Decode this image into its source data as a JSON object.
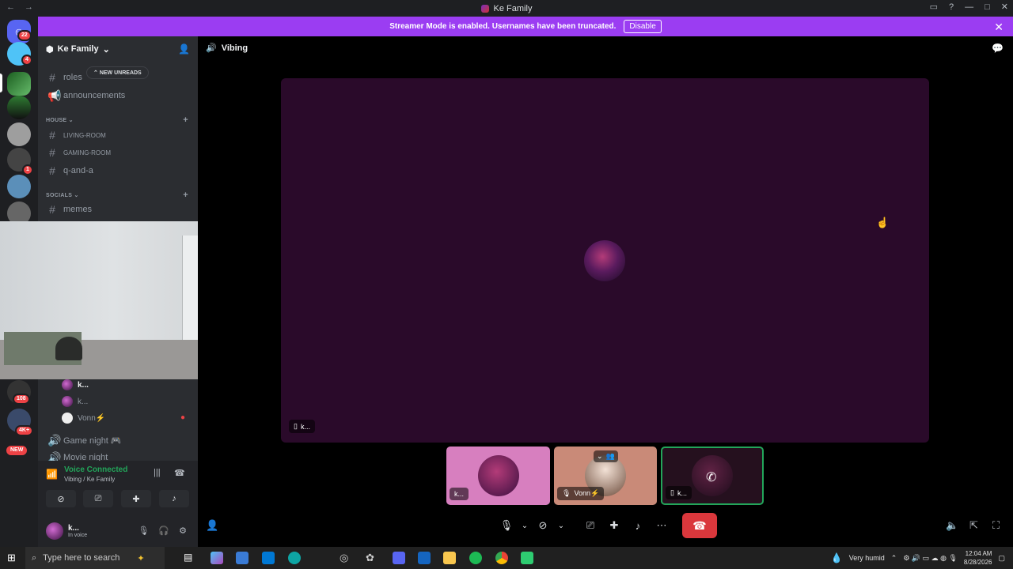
{
  "window": {
    "title": "Ke Family",
    "back_icon": "arrow-left-icon",
    "forward_icon": "arrow-right-icon"
  },
  "banner": {
    "text": "Streamer Mode is enabled. Usernames have been truncated.",
    "button": "Disable",
    "color": "#9b3df2"
  },
  "rail": {
    "badges": [
      "22",
      "4",
      "1",
      "108",
      "4K+",
      "NEW"
    ]
  },
  "sidebar": {
    "guild_name": "Ke Family",
    "new_unreads": "NEW UNREADS",
    "channels_top": [
      "roles",
      "announcements"
    ],
    "category_house": "HOUSE",
    "channels_house": [
      "LIVING-ROOM",
      "GAMING-ROOM",
      "q-and-a"
    ],
    "category_socials": "SOCIALS",
    "channels_socials": [
      "memes"
    ],
    "voice_users": [
      "k...",
      "k...",
      "Vonn⚡"
    ],
    "voice_channels": [
      "Game night 🎮",
      "Movie night"
    ]
  },
  "voice_panel": {
    "status": "Voice Connected",
    "location": "Vibing / Ke Family",
    "username": "k...",
    "user_status": "In voice"
  },
  "stage": {
    "channel": "Vibing",
    "main_label": "k...",
    "thumbs": [
      {
        "label": "k..."
      },
      {
        "label": "Vonn⚡"
      },
      {
        "label": "k..."
      }
    ],
    "end_call_color": "#da373c"
  },
  "taskbar": {
    "search_placeholder": "Type here to search",
    "weather": "Very humid",
    "time": "12:04 AM",
    "date": "8/28/2026"
  }
}
